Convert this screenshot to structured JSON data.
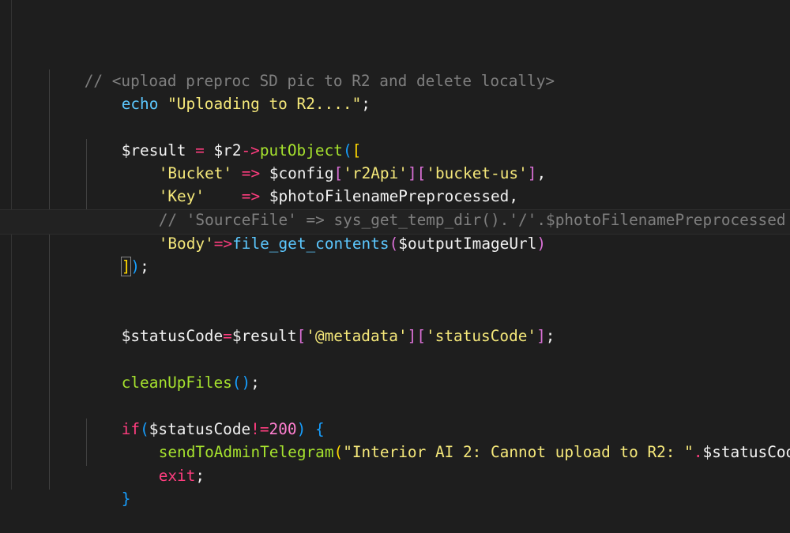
{
  "colors": {
    "background": "#1e1e1e",
    "comment": "#7f7f7f",
    "string": "#f5e87a",
    "keyword": "#ff3d7f",
    "function": "#a6e22e",
    "bracket_yellow": "#ffd700",
    "bracket_purple": "#da70d6",
    "bracket_blue": "#179fff"
  },
  "code": {
    "l1": {
      "comment": "// <upload preproc SD pic to R2 and delete locally>"
    },
    "l2": {
      "echo": "echo",
      "sp": " ",
      "str": "\"Uploading to R2....\"",
      "semi": ";"
    },
    "l4": {
      "var": "$result",
      "eq": " = ",
      "obj": "$r2",
      "arrow": "->",
      "method": "putObject",
      "p1": "(",
      "b1": "["
    },
    "l5": {
      "key": "'Bucket'",
      "arrow": " => ",
      "var": "$config",
      "b1": "[",
      "k1": "'r2Api'",
      "b2": "][",
      "k2": "'bucket-us'",
      "b3": "]",
      "comma": ","
    },
    "l6": {
      "key": "'Key'",
      "pad": "    ",
      "arrow": "=> ",
      "var": "$photoFilenamePreprocessed",
      "comma": ","
    },
    "l7": {
      "comment": "// 'SourceFile' => sys_get_temp_dir().'/'.$photoFilenamePreprocessed"
    },
    "l8": {
      "key": "'Body'",
      "arrow": "=>",
      "fn": "file_get_contents",
      "p1": "(",
      "var": "$outputImageUrl",
      "p2": ")"
    },
    "l9": {
      "b1": "]",
      "p1": ")",
      "semi": ";"
    },
    "l12": {
      "var": "$statusCode",
      "eq": "=",
      "var2": "$result",
      "b1": "[",
      "k1": "'@metadata'",
      "b2": "][",
      "k2": "'statusCode'",
      "b3": "]",
      "semi": ";"
    },
    "l14": {
      "fn": "cleanUpFiles",
      "parens": "()",
      "semi": ";"
    },
    "l16": {
      "kw": "if",
      "p1": "(",
      "var": "$statusCode",
      "op": "!=",
      "num": "200",
      "p2": ")",
      "sp": " ",
      "brace": "{"
    },
    "l17": {
      "fn": "sendToAdminTelegram",
      "p1": "(",
      "str": "\"Interior AI 2: Cannot upload to R2: \"",
      "dot": ".",
      "var": "$statusCode",
      "dot2": ".",
      "str2": "\""
    },
    "l18": {
      "kw": "exit",
      "semi": ";"
    },
    "l19": {
      "brace": "}"
    }
  }
}
